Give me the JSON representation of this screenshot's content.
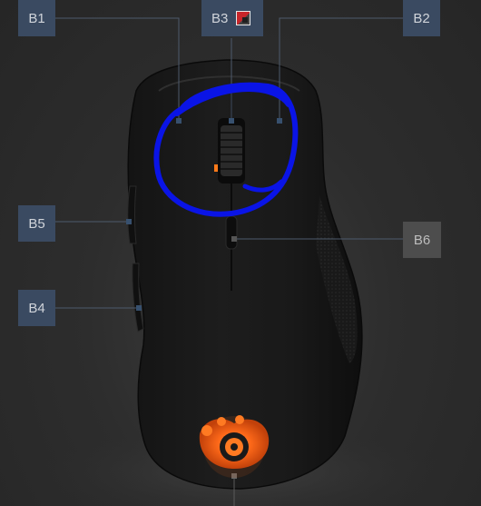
{
  "buttons": {
    "b1": {
      "label": "B1"
    },
    "b2": {
      "label": "B2"
    },
    "b3": {
      "label": "B3",
      "swatch_color": "#c8262b"
    },
    "b4": {
      "label": "B4"
    },
    "b5": {
      "label": "B5"
    },
    "b6": {
      "label": "B6"
    }
  },
  "colors": {
    "background": "#2b2b2b",
    "label_active": "#3a4a61",
    "label_inactive": "#4d4d4d",
    "logo_glow": "#ff6a1a",
    "annotation_circle": "#0a14e6"
  },
  "icons": {
    "logo": "steelseries-logo-icon",
    "b3_color": "color-swatch-icon"
  }
}
